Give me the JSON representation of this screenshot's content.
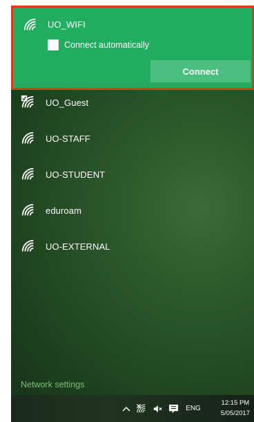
{
  "networks": {
    "selected": {
      "name": "UO_WIFI",
      "connect_automatically_label": "Connect automatically",
      "connect_automatically_checked": false,
      "connect_label": "Connect",
      "icon": "wifi-icon"
    },
    "others": [
      {
        "name": "UO_Guest",
        "icon": "wifi-open-icon"
      },
      {
        "name": "UO-STAFF",
        "icon": "wifi-icon"
      },
      {
        "name": "UO-STUDENT",
        "icon": "wifi-icon"
      },
      {
        "name": "eduroam",
        "icon": "wifi-icon"
      },
      {
        "name": "UO-EXTERNAL",
        "icon": "wifi-icon"
      }
    ]
  },
  "footer": {
    "network_settings_label": "Network settings"
  },
  "taskbar": {
    "language": "ENG",
    "time": "12:15 PM",
    "date": "5/05/2017"
  },
  "colors": {
    "selected_background": "#20ad5f",
    "selection_outline": "#e03a1d",
    "connect_button": "#4bbf7f",
    "link_text": "#7bbf73"
  }
}
